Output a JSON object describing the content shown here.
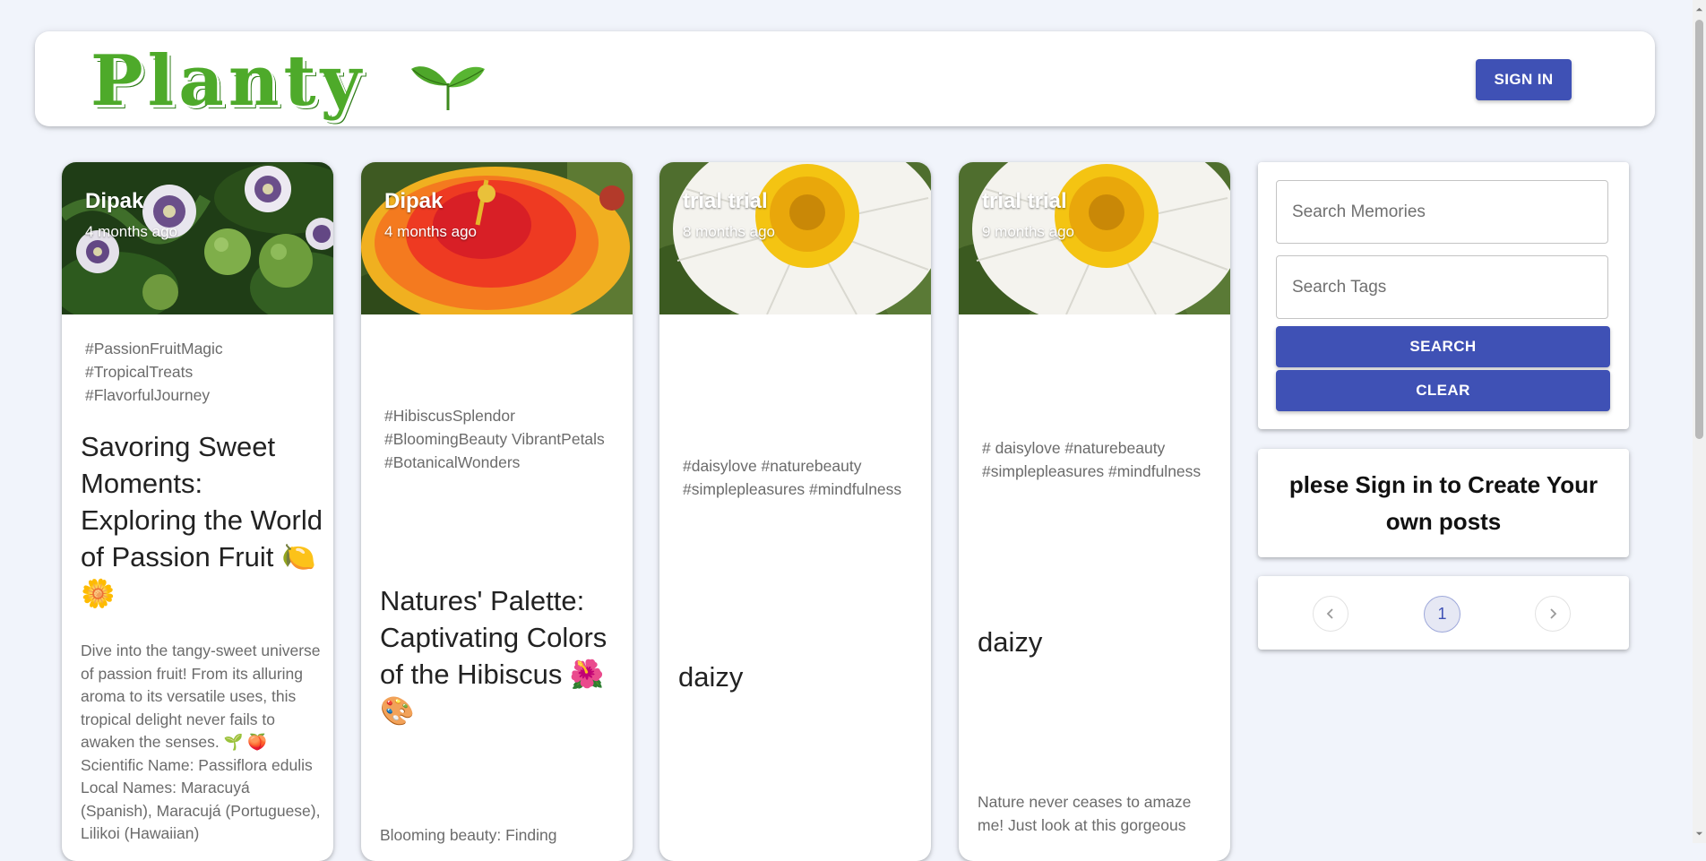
{
  "header": {
    "logo_text": "Planty",
    "signin_label": "SIGN IN"
  },
  "posts": [
    {
      "author": "Dipak",
      "time": "4 months ago",
      "tags": "#PassionFruitMagic #TropicalTreats #FlavorfulJourney",
      "title": "Savoring Sweet Moments: Exploring the World of Passion Fruit 🍋 🌼",
      "body": "Dive into the tangy-sweet universe of passion fruit! From its alluring aroma to its versatile uses, this tropical delight never fails to awaken the senses. 🌱 🍑 Scientific Name: Passiflora edulis Local Names: Maracuyá (Spanish), Maracujá (Portuguese), Lilikoi (Hawaiian)",
      "image": "passion-fruit-photo"
    },
    {
      "author": "Dipak",
      "time": "4 months ago",
      "tags": "#HibiscusSplendor #BloomingBeauty VibrantPetals #BotanicalWonders",
      "title": "Natures' Palette: Captivating Colors of the Hibiscus 🌺 🎨",
      "body": "Blooming beauty: Finding",
      "image": "hibiscus-photo"
    },
    {
      "author": "trial trial",
      "time": "8 months ago",
      "tags": "#daisylove #naturebeauty #simplepleasures #mindfulness",
      "title": "daizy",
      "body": "",
      "image": "daisy-photo"
    },
    {
      "author": "trial trial",
      "time": "9 months ago",
      "tags": "# daisylove #naturebeauty #simplepleasures #mindfulness",
      "title": "daizy",
      "body": "Nature never ceases to amaze me! Just look at this gorgeous",
      "image": "daisy-photo"
    }
  ],
  "search": {
    "memories_placeholder": "Search Memories",
    "tags_placeholder": "Search Tags",
    "search_label": "SEARCH",
    "clear_label": "CLEAR"
  },
  "signin_prompt": "plese Sign in to Create Your own posts",
  "pagination": {
    "current_page": "1",
    "prev_icon": "chevron-left-icon",
    "next_icon": "chevron-right-icon"
  },
  "colors": {
    "primary": "#3f51b5",
    "logo_green": "#4eaa2a",
    "background": "#f1f4fb"
  }
}
